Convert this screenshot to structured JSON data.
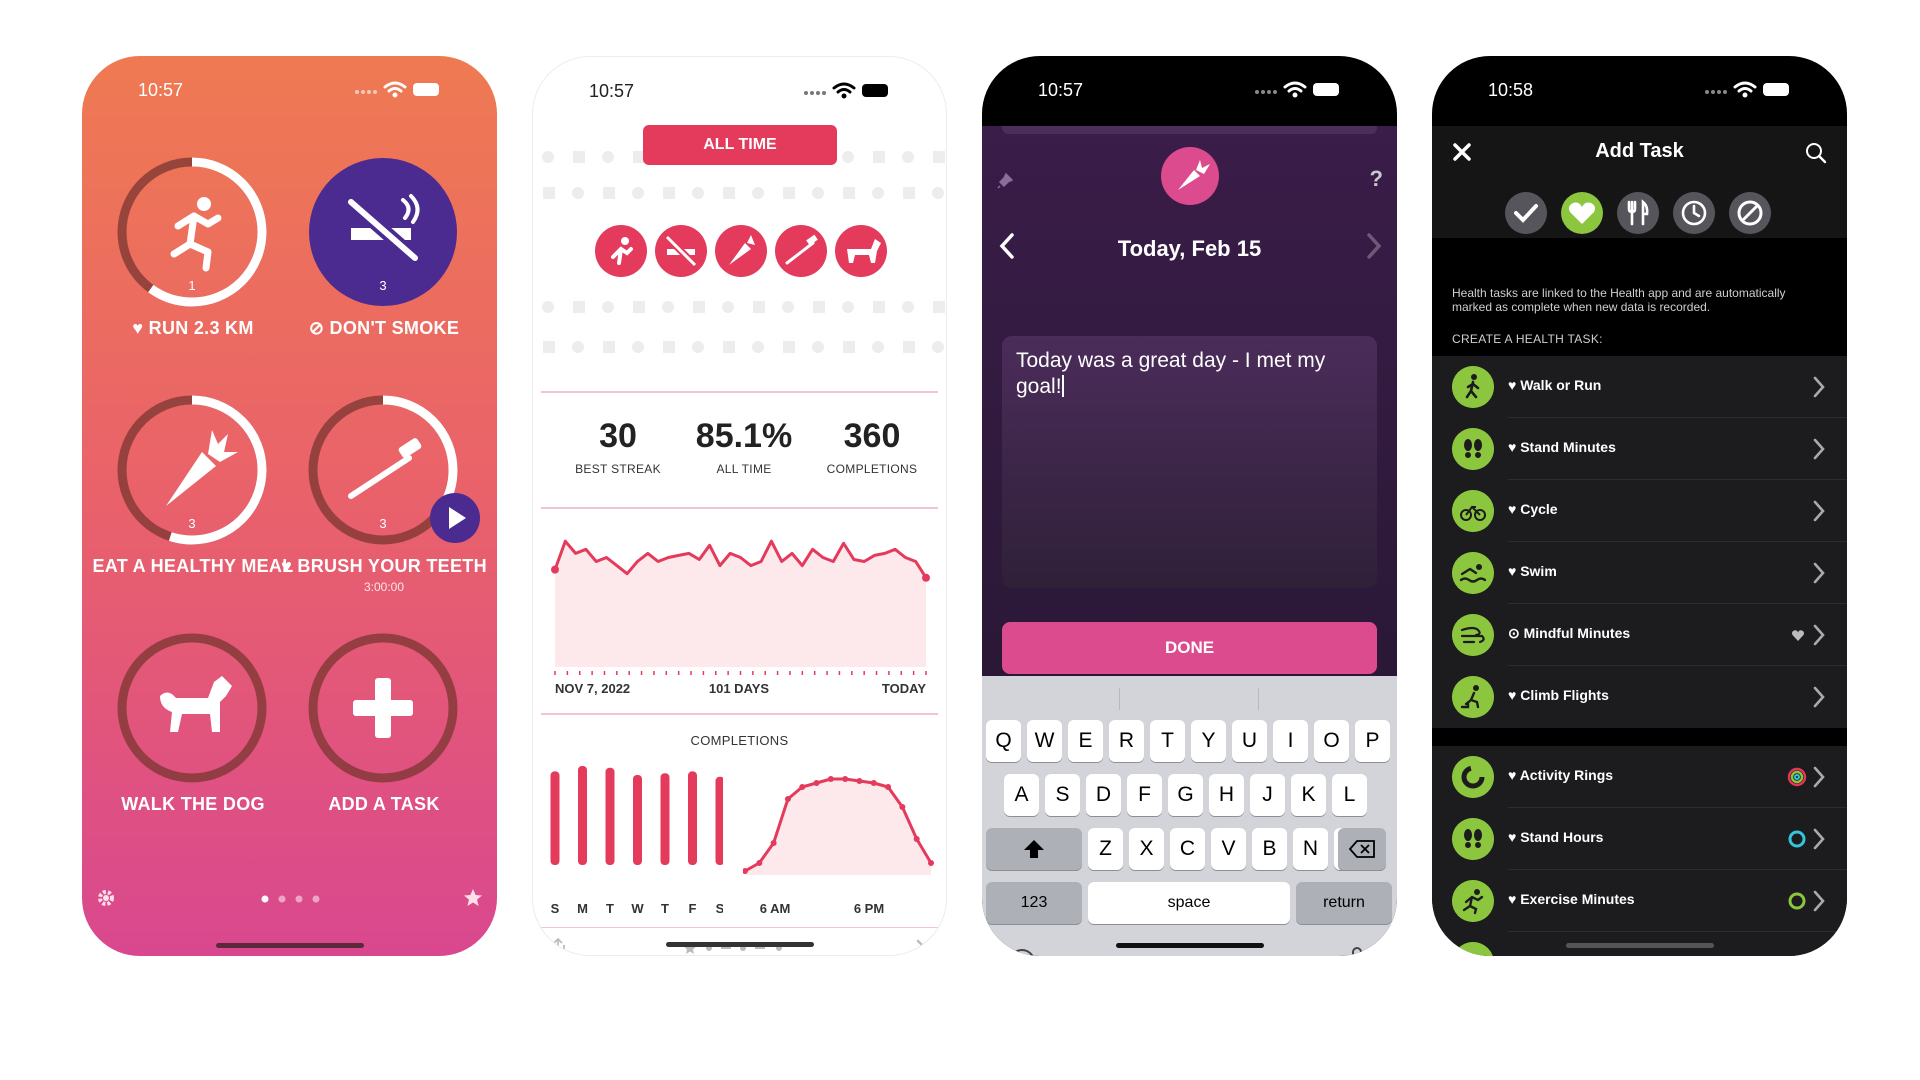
{
  "colors": {
    "gradient_top": "#ef7a52",
    "gradient_bottom": "#d9488f",
    "accent_red": "#e43a5b",
    "accent_pink": "#dc4b8e",
    "purple": "#4b2b8f",
    "health_green": "#8cc63f"
  },
  "screen1": {
    "time": "10:57",
    "habits": [
      {
        "label": "RUN 2.3 KM",
        "count": "1",
        "progress": 0.6,
        "icon": "runner-icon",
        "prefix": "heart-icon"
      },
      {
        "label": "DON'T SMOKE",
        "count": "3",
        "progress": 1.0,
        "icon": "no-smoking-icon",
        "prefix": "no-icon"
      },
      {
        "label": "EAT A HEALTHY MEAL",
        "count": "3",
        "progress": 0.55,
        "icon": "carrot-icon"
      },
      {
        "label": "BRUSH YOUR TEETH",
        "count": "3",
        "sub": "3:00:00",
        "progress": 0.35,
        "icon": "toothbrush-icon",
        "prefix": "heart-icon"
      },
      {
        "label": "WALK THE DOG",
        "progress": 0.0,
        "icon": "dog-icon"
      },
      {
        "label": "ADD A TASK",
        "progress": 0.0,
        "icon": "plus-icon"
      }
    ]
  },
  "screen2": {
    "time": "10:57",
    "filter_label": "ALL TIME",
    "stats": [
      {
        "value": "30",
        "label": "BEST STREAK"
      },
      {
        "value": "85.1%",
        "label": "ALL TIME"
      },
      {
        "value": "360",
        "label": "COMPLETIONS"
      }
    ],
    "timeline": {
      "start": "NOV 7, 2022",
      "middle": "101 DAYS",
      "end": "TODAY"
    },
    "completions_title": "COMPLETIONS",
    "weekday_labels": [
      "S",
      "M",
      "T",
      "W",
      "T",
      "F",
      "S"
    ],
    "hour_labels": [
      "6 AM",
      "6 PM"
    ]
  },
  "chart_data": [
    {
      "type": "area",
      "title": "",
      "x": [
        "NOV 7, 2022",
        "TODAY"
      ],
      "series": [
        {
          "values": [
            0.78,
            0.92,
            0.86,
            0.88,
            0.82,
            0.84,
            0.8,
            0.76,
            0.82,
            0.86,
            0.82,
            0.84,
            0.85,
            0.86,
            0.83,
            0.9,
            0.8,
            0.86,
            0.84,
            0.8,
            0.82,
            0.92,
            0.82,
            0.86,
            0.8,
            0.88,
            0.84,
            0.82,
            0.91,
            0.83,
            0.82,
            0.85,
            0.86,
            0.88,
            0.84,
            0.82,
            0.74
          ]
        }
      ]
    },
    {
      "type": "bar",
      "title": "COMPLETIONS",
      "categories": [
        "S",
        "M",
        "T",
        "W",
        "T",
        "F",
        "S"
      ],
      "values": [
        52,
        55,
        54,
        50,
        51,
        52,
        49
      ]
    },
    {
      "type": "area",
      "title": "",
      "x": [
        "6 AM",
        "6 PM"
      ],
      "series": [
        {
          "values": [
            2,
            6,
            16,
            38,
            44,
            46,
            48,
            48,
            47,
            46,
            44,
            34,
            18,
            6
          ]
        }
      ]
    }
  ],
  "screen3": {
    "time": "10:57",
    "date_title": "Today, Feb 15",
    "help": "?",
    "note_text": "Today was a great day - I met my goal!",
    "done_label": "DONE",
    "keys_row1": [
      "Q",
      "W",
      "E",
      "R",
      "T",
      "Y",
      "U",
      "I",
      "O",
      "P"
    ],
    "keys_row2": [
      "A",
      "S",
      "D",
      "F",
      "G",
      "H",
      "J",
      "K",
      "L"
    ],
    "keys_row3": [
      "Z",
      "X",
      "C",
      "V",
      "B",
      "N",
      "M"
    ],
    "key_123": "123",
    "key_space": "space",
    "key_return": "return"
  },
  "screen4": {
    "time": "10:58",
    "title": "Add Task",
    "health_note": "Health tasks are linked to the Health app and are automatically marked as complete when new data is recorded.",
    "section_label": "CREATE A HEALTH TASK:",
    "tasks_group1": [
      {
        "label": "Walk or Run",
        "icon": "walk-icon"
      },
      {
        "label": "Stand Minutes",
        "icon": "footprints-icon"
      },
      {
        "label": "Cycle",
        "icon": "bicycle-icon"
      },
      {
        "label": "Swim",
        "icon": "swim-icon"
      },
      {
        "label": "Mindful Minutes",
        "icon": "mindful-icon",
        "badge": "heart-badge-icon"
      },
      {
        "label": "Climb Flights",
        "icon": "stairs-icon"
      }
    ],
    "tasks_group2": [
      {
        "label": "Activity Rings",
        "icon": "ring-icon",
        "badge": "activity-rings-icon"
      },
      {
        "label": "Stand Hours",
        "icon": "footprints-icon",
        "badge": "stand-ring-icon"
      },
      {
        "label": "Exercise Minutes",
        "icon": "runner-icon",
        "badge": "exercise-ring-icon"
      }
    ]
  }
}
